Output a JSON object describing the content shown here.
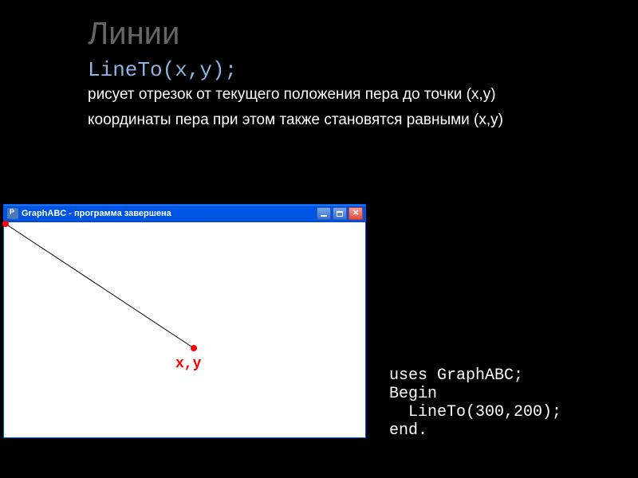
{
  "slide": {
    "title": "Линии",
    "func": "LineTo(x,y);",
    "desc1": "рисует отрезок от текущего положения пера до точки (x,y)",
    "desc2": "координаты пера при этом также становятся равными (x,y)"
  },
  "window": {
    "title": "GraphABC - программа завершена",
    "xy_label": "x,y"
  },
  "code": {
    "line1": "uses GraphABC;",
    "line2": "Begin",
    "line3": "  LineTo(300,200);",
    "line4": "end."
  }
}
